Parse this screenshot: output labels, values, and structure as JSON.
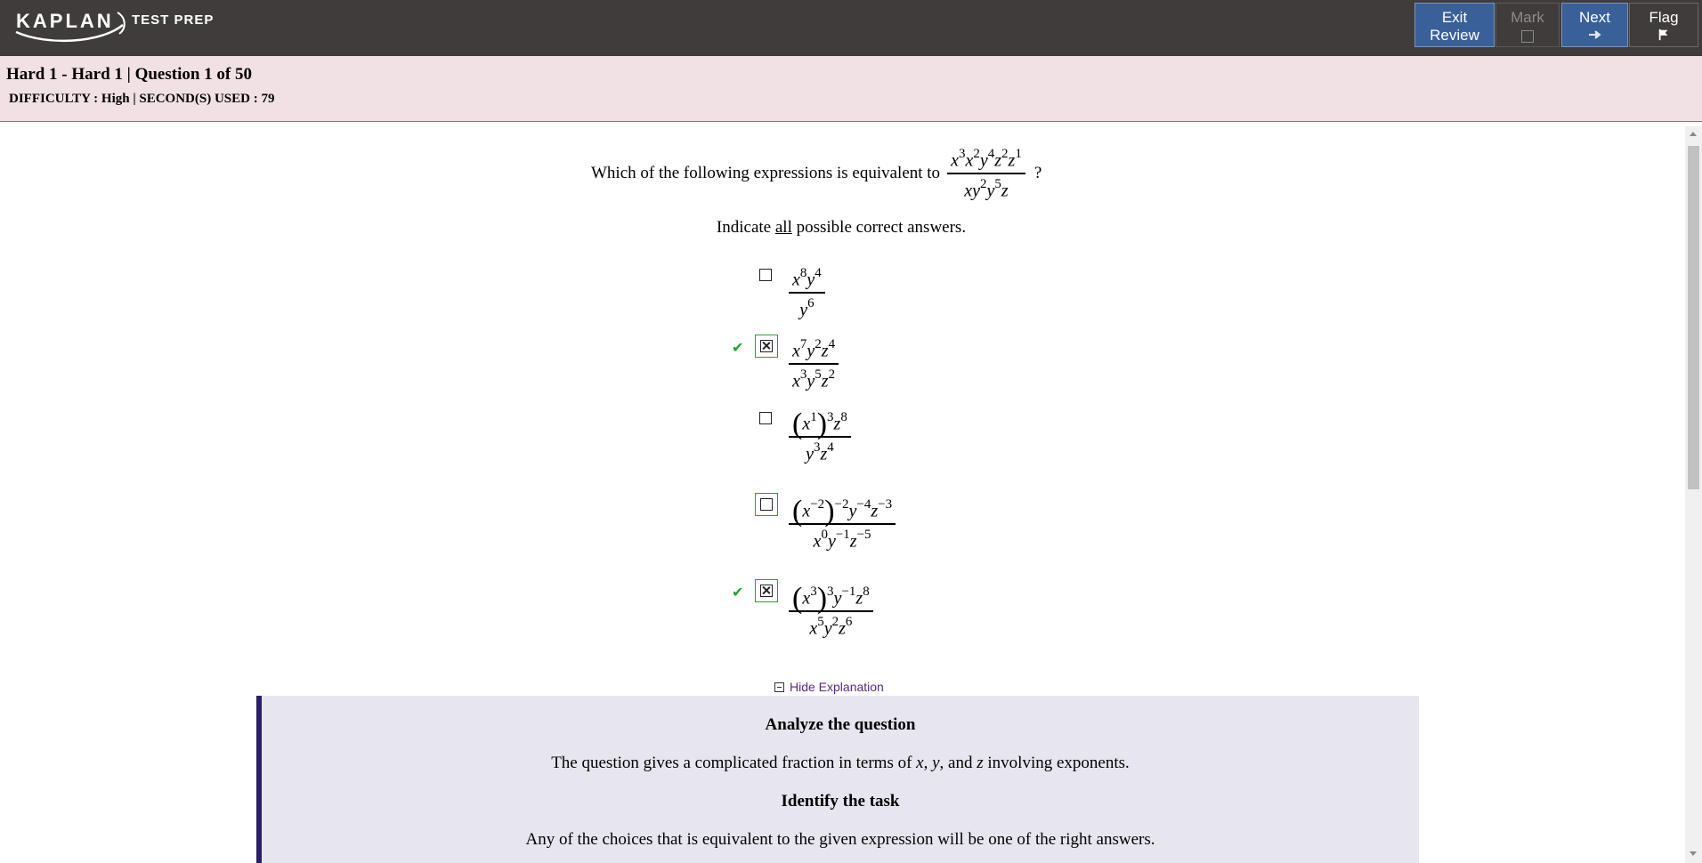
{
  "app": {
    "logo_text": "KAPLAN",
    "logo_subtext": "TEST PREP"
  },
  "toolbar": {
    "exit_label_1": "Exit",
    "exit_label_2": "Review",
    "mark_label": "Mark",
    "next_label": "Next",
    "flag_label": "Flag",
    "accent_color": "#3a6099"
  },
  "header": {
    "title": "Hard 1 - Hard 1 | Question 1 of 50",
    "meta": "DIFFICULTY : High | SECOND(S) USED : 79"
  },
  "question": {
    "stem": "Which of the following expressions is equivalent to",
    "stem_end": "?",
    "instruction_pre": "Indicate ",
    "instruction_u": "all",
    "instruction_post": " possible correct answers."
  },
  "choices": [
    {
      "selected": false,
      "correct": false
    },
    {
      "selected": true,
      "correct": true
    },
    {
      "selected": false,
      "correct": false
    },
    {
      "selected": false,
      "correct": false
    },
    {
      "selected": true,
      "correct": true
    }
  ],
  "explanation": {
    "toggle_label": "Hide Explanation",
    "heading_1": "Analyze the question",
    "text_1_pre": "The question gives a complicated fraction in terms of ",
    "text_1_x": "x",
    "text_1_sep1": ", ",
    "text_1_y": "y",
    "text_1_sep2": ", and ",
    "text_1_z": "z",
    "text_1_post": " involving exponents.",
    "heading_2": "Identify the task",
    "text_2": "Any of the choices that is equivalent to the given expression will be one of the right answers."
  }
}
